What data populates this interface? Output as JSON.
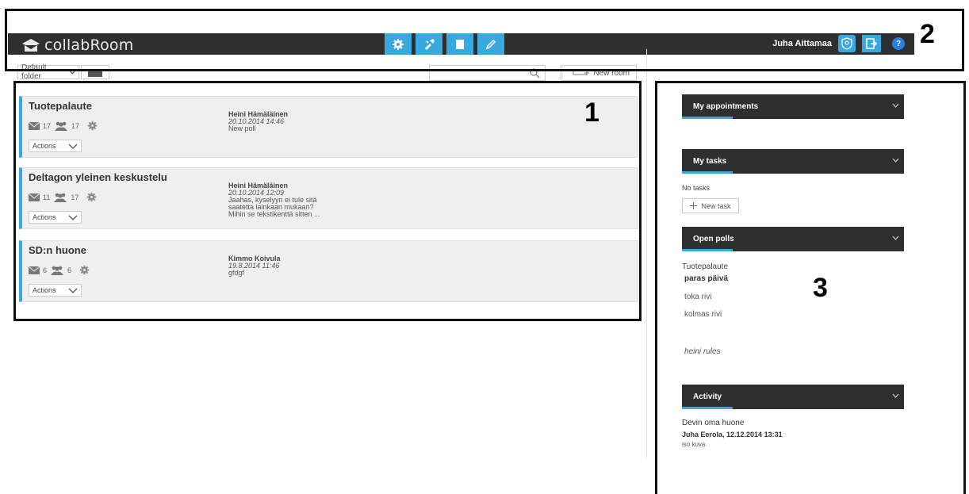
{
  "app": {
    "logo_text": "collabRoom",
    "user_name": "Juha Aittamaa",
    "help_label": "?"
  },
  "toolbar": {
    "folder_label": "Default folder",
    "new_room_label": "New room"
  },
  "rooms": [
    {
      "title": "Tuotepalaute",
      "messages": "17",
      "members": "17",
      "actions_label": "Actions",
      "last_author": "Heini Hämäläinen",
      "last_date": "20.10.2014 14:46",
      "last_message_lines": [
        "New poll"
      ]
    },
    {
      "title": "Deltagon yleinen keskustelu",
      "messages": "11",
      "members": "17",
      "actions_label": "Actions",
      "last_author": "Heini Hämäläinen",
      "last_date": "20.10.2014 12:09",
      "last_message_lines": [
        "Jaahas, kyselyyn ei tule sitä",
        "saatetta lainkaan mukaan?",
        "Mihin se tekstikenttä sitten ..."
      ]
    },
    {
      "title": "SD:n huone",
      "messages": "6",
      "members": "6",
      "actions_label": "Actions",
      "last_author": "Kimmo Koivula",
      "last_date": "19.8.2014 11:46",
      "last_message_lines": [
        "gfdgf"
      ]
    }
  ],
  "sidebar": {
    "appointments": {
      "title": "My appointments"
    },
    "tasks": {
      "title": "My tasks",
      "empty_text": "No tasks",
      "new_task_label": "New task"
    },
    "polls": {
      "title": "Open polls",
      "poll_room": "Tuotepalaute",
      "question": "paras päivä",
      "options": [
        "toka rivi",
        "kolmas rivi"
      ],
      "extra": "heini rules"
    },
    "activity": {
      "title": "Activity",
      "room": "Devin oma huone",
      "by": "Juha Eerola, 12.12.2014 13:31",
      "message": "iso kuva"
    }
  },
  "annotations": {
    "a1": "1",
    "a2": "2",
    "a3": "3"
  },
  "colors": {
    "accent": "#39a9dd",
    "bar": "#2f2f2f",
    "card": "#efefef"
  }
}
